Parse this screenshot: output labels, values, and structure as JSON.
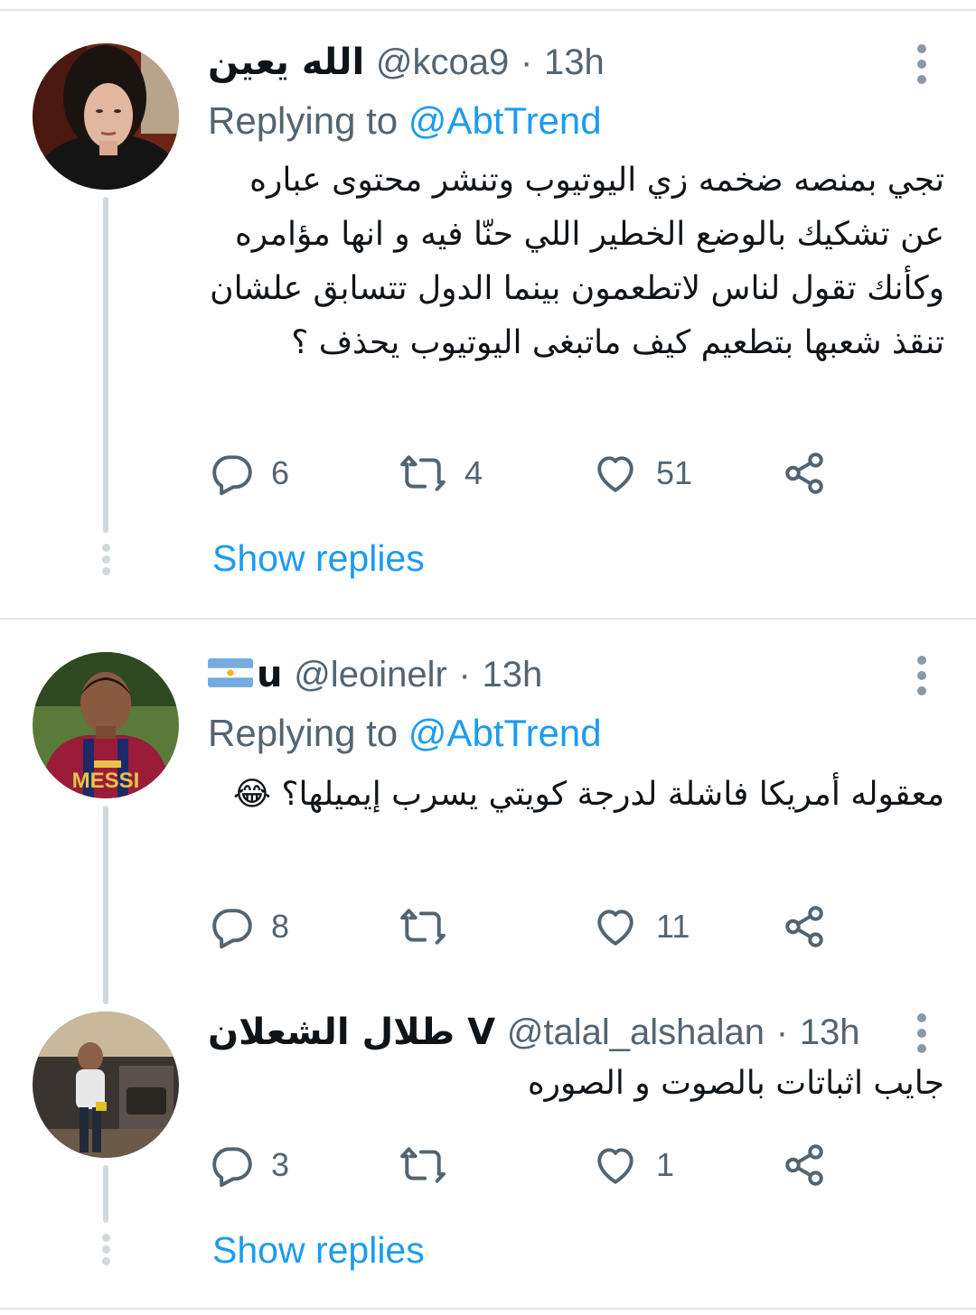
{
  "tweets": [
    {
      "name": "الله يعين",
      "handle": "@kcoa9",
      "separator": "·",
      "time": "13h",
      "replying_prefix": "Replying to ",
      "replying_to": "@AbtTrend",
      "text": "تجي بمنصه ضخمه زي اليوتيوب وتنشر محتوى عباره عن تشكيك بالوضع الخطير اللي حنّا فيه و انها مؤامره  وكأنك تقول لناس لاتطعمون بينما الدول تتسابق علشان تنقذ شعبها بتطعيم كيف ماتبغى اليوتيوب يحذف ؟",
      "replies": "6",
      "retweets": "4",
      "likes": "51",
      "show_replies": "Show replies"
    },
    {
      "name": "u",
      "handle": "@leoinelr",
      "separator": "·",
      "time": "13h",
      "replying_prefix": "Replying to ",
      "replying_to": "@AbtTrend",
      "text": "معقوله أمريكا فاشلة لدرجة كويتي يسرب إيميلها؟ 😂",
      "replies": "8",
      "retweets": "",
      "likes": "11"
    },
    {
      "name": "طلال الشعلان V",
      "handle": "@talal_alshalan",
      "separator": "·",
      "time": "13h",
      "text": "جايب اثباتات بالصوت و الصوره",
      "replies": "3",
      "retweets": "",
      "likes": "1",
      "show_replies": "Show replies"
    }
  ],
  "icons": [
    "reply-icon",
    "retweet-icon",
    "like-icon",
    "share-icon",
    "more-icon",
    "argentina-flag-icon"
  ],
  "colors": {
    "link": "#1d9bf0",
    "secondary": "#536471",
    "divider": "#e1e5e9",
    "thread": "#cfd9de"
  }
}
